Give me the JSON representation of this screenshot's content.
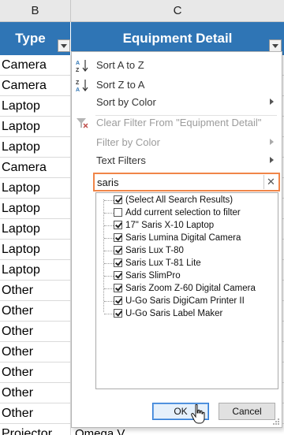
{
  "columns": {
    "b": "B",
    "c": "C"
  },
  "header": {
    "type": "Type",
    "detail": "Equipment Detail"
  },
  "rows": [
    "Camera",
    "Camera",
    "Laptop",
    "Laptop",
    "Laptop",
    "Camera",
    "Laptop",
    "Laptop",
    "Laptop",
    "Laptop",
    "Laptop",
    "Other",
    "Other",
    "Other",
    "Other",
    "Other",
    "Other",
    "Other"
  ],
  "partial_row": {
    "type": "Projector",
    "detail": "Omega V..."
  },
  "menu": {
    "sort_az": "Sort A to Z",
    "sort_za": "Sort Z to A",
    "sort_color": "Sort by Color",
    "clear_filter": "Clear Filter From \"Equipment Detail\"",
    "filter_color": "Filter by Color",
    "text_filters": "Text Filters"
  },
  "search": {
    "value": "saris"
  },
  "tree": [
    {
      "label": "(Select All Search Results)",
      "checked": true
    },
    {
      "label": "Add current selection to filter",
      "checked": false
    },
    {
      "label": "17\" Saris X-10 Laptop",
      "checked": true
    },
    {
      "label": "Saris Lumina Digital Camera",
      "checked": true
    },
    {
      "label": "Saris Lux T-80",
      "checked": true
    },
    {
      "label": "Saris Lux T-81 Lite",
      "checked": true
    },
    {
      "label": "Saris SlimPro",
      "checked": true
    },
    {
      "label": "Saris Zoom Z-60 Digital Camera",
      "checked": true
    },
    {
      "label": "U-Go Saris DigiCam Printer II",
      "checked": true
    },
    {
      "label": "U-Go Saris Label Maker",
      "checked": true
    }
  ],
  "buttons": {
    "ok": "OK",
    "cancel": "Cancel"
  },
  "colors": {
    "header_blue": "#2f75b5",
    "search_highlight": "#f08548"
  }
}
